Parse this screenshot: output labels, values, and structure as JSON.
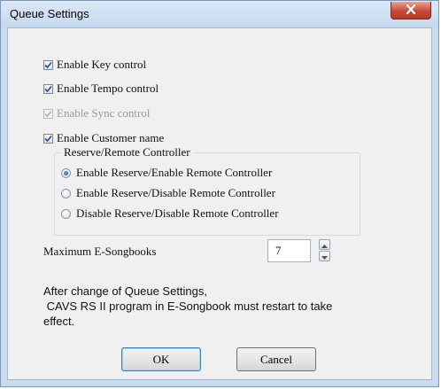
{
  "window": {
    "title": "Queue Settings"
  },
  "checkboxes": [
    {
      "label": "Enable Key control",
      "checked": true,
      "disabled": false
    },
    {
      "label": "Enable Tempo control",
      "checked": true,
      "disabled": false
    },
    {
      "label": "Enable Sync control",
      "checked": true,
      "disabled": true
    },
    {
      "label": "Enable Customer name",
      "checked": true,
      "disabled": false
    }
  ],
  "reserve_group": {
    "title": "Reserve/Remote Controller",
    "options": [
      {
        "label": "Enable Reserve/Enable Remote Controller",
        "selected": true
      },
      {
        "label": "Enable Reserve/Disable Remote Controller",
        "selected": false
      },
      {
        "label": "Disable Reserve/Disable Remote Controller",
        "selected": false
      }
    ]
  },
  "max_songbooks": {
    "label": "Maximum E-Songbooks",
    "value": "7"
  },
  "note": {
    "line1": "After change of Queue Settings,",
    "line2": " CAVS RS II program in E-Songbook must restart to take",
    "line3": "effect."
  },
  "buttons": {
    "ok": "OK",
    "cancel": "Cancel"
  },
  "icons": {
    "close": "close-icon",
    "check": "checkmark-icon",
    "spin_up": "arrow-up-icon",
    "spin_down": "arrow-down-icon"
  }
}
